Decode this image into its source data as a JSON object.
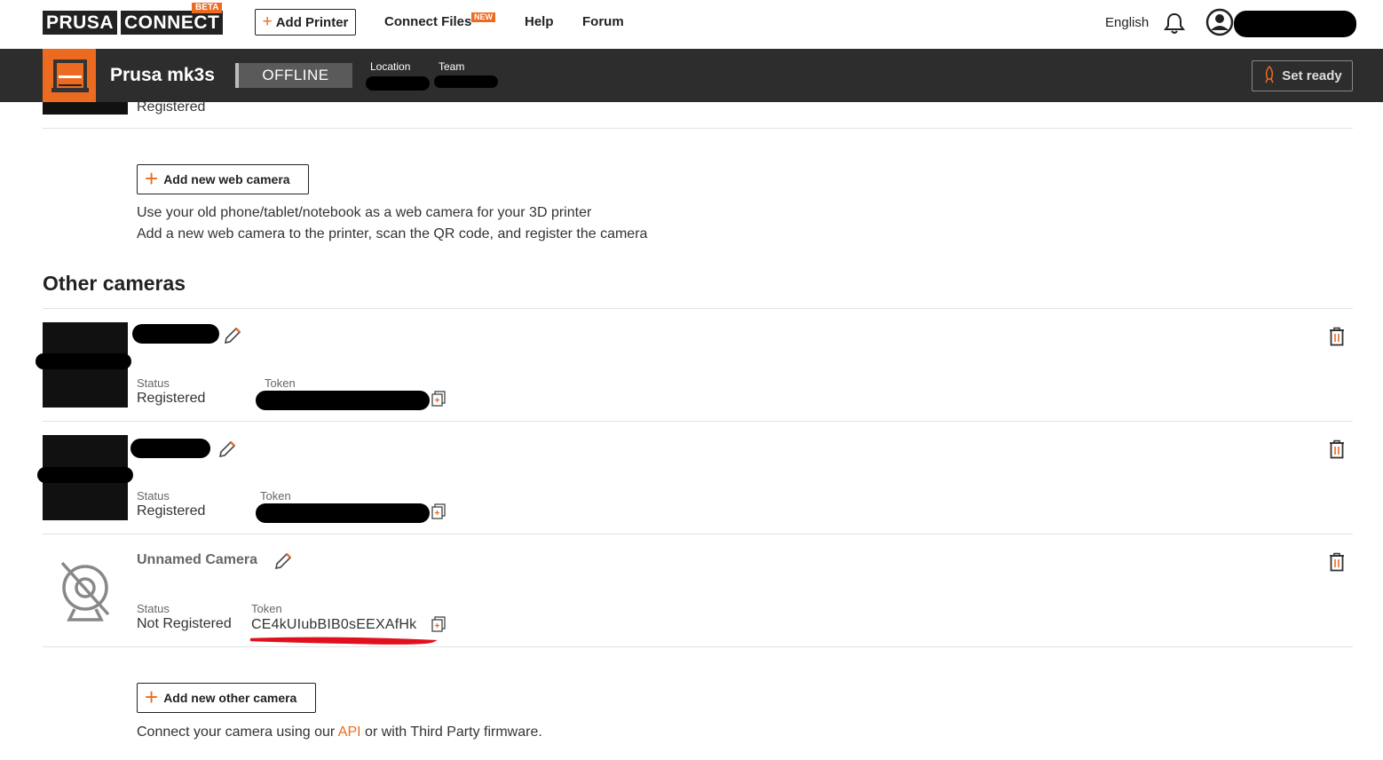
{
  "nav": {
    "logo_left": "PRUSA",
    "logo_right": "CONNECT",
    "beta_badge": "BETA",
    "add_printer": "Add Printer",
    "connect_files": "Connect Files",
    "new_badge": "NEW",
    "help": "Help",
    "forum": "Forum",
    "language": "English"
  },
  "printer": {
    "name": "Prusa mk3s",
    "state": "OFFLINE",
    "location_label": "Location",
    "team_label": "Team",
    "set_ready": "Set ready"
  },
  "webcams": {
    "top_status": "Registered",
    "add_button": "Add new web camera",
    "desc_line1": "Use your old phone/tablet/notebook as a web camera for your 3D printer",
    "desc_line2": "Add a new web camera to the printer, scan the QR code, and register the camera"
  },
  "other_cameras": {
    "title": "Other cameras",
    "cameras": [
      {
        "status_label": "Status",
        "status": "Registered",
        "token_label": "Token"
      },
      {
        "status_label": "Status",
        "status": "Registered",
        "token_label": "Token"
      },
      {
        "name": "Unnamed Camera",
        "status_label": "Status",
        "status": "Not Registered",
        "token_label": "Token",
        "token": "CE4kUIubBIB0sEEXAfHk"
      }
    ],
    "add_button": "Add new other camera",
    "footer_prefix": "Connect your camera using our",
    "footer_link": "API",
    "footer_suffix": "or with Third Party firmware."
  },
  "colors": {
    "accent": "#ed6b21",
    "bar": "#2d2d2d",
    "underline": "#e0101c"
  }
}
